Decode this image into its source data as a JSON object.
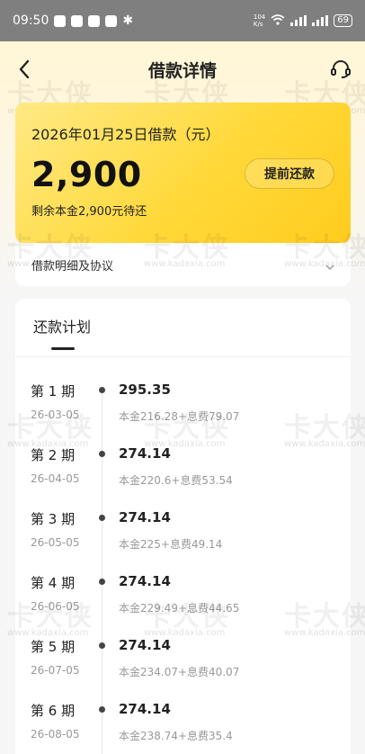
{
  "status_bar": {
    "time": "09:50",
    "net_speed_top": "104",
    "net_speed_bottom": "K/s",
    "battery": "69"
  },
  "header": {
    "title": "借款详情"
  },
  "loan": {
    "date_label": "2026年01月25日借款（元）",
    "amount": "2,900",
    "remaining": "剩余本金2,900元待还",
    "prepay_label": "提前还款"
  },
  "details": {
    "label": "借款明细及协议"
  },
  "plan": {
    "tab_label": "还款计划",
    "items": [
      {
        "period": "第 1 期",
        "date": "26-03-05",
        "amount": "295.35",
        "breakdown": "本金216.28+息费79.07"
      },
      {
        "period": "第 2 期",
        "date": "26-04-05",
        "amount": "274.14",
        "breakdown": "本金220.6+息费53.54"
      },
      {
        "period": "第 3 期",
        "date": "26-05-05",
        "amount": "274.14",
        "breakdown": "本金225+息费49.14"
      },
      {
        "period": "第 4 期",
        "date": "26-06-05",
        "amount": "274.14",
        "breakdown": "本金229.49+息费44.65"
      },
      {
        "period": "第 5 期",
        "date": "26-07-05",
        "amount": "274.14",
        "breakdown": "本金234.07+息费40.07"
      },
      {
        "period": "第 6 期",
        "date": "26-08-05",
        "amount": "274.14",
        "breakdown": "本金238.74+息费35.4"
      }
    ]
  },
  "watermark": {
    "brand": "卡大侠",
    "url": "www.kadaxia.com"
  },
  "colors": {
    "card_gradient_start": "#ffe985",
    "card_gradient_end": "#ffcc1d",
    "header_bg": "#fff7d6"
  }
}
